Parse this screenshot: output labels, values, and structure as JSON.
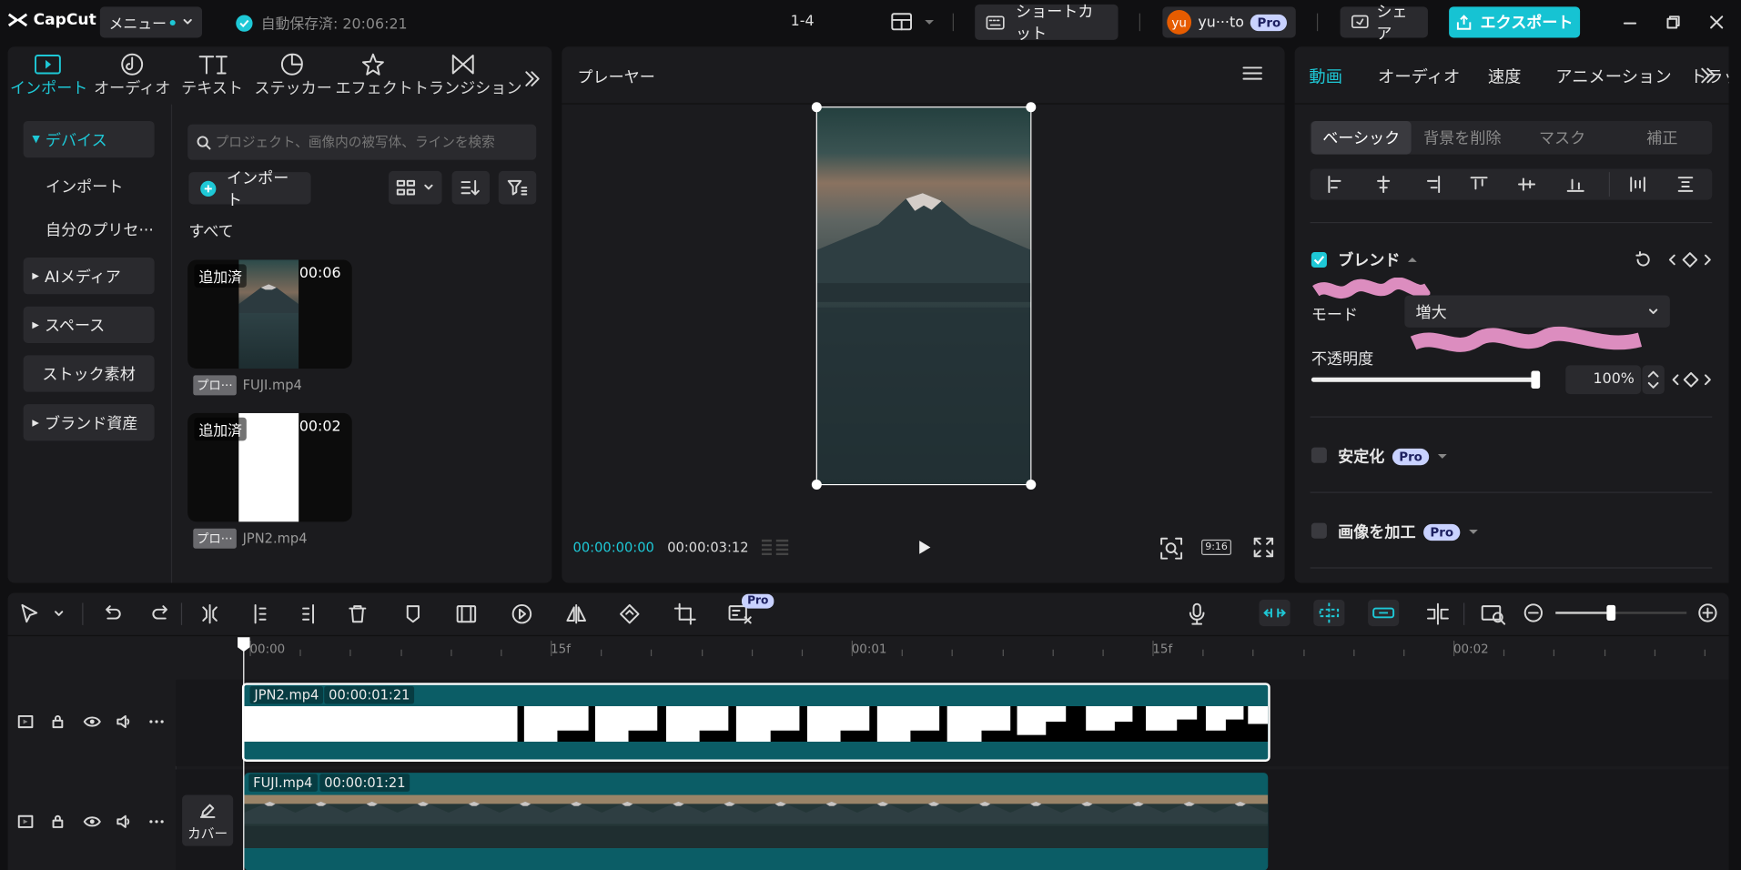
{
  "app": {
    "logo": "CapCut",
    "menu_label": "メニュー",
    "autosave": "自動保存済: 20:06:21",
    "project_name": "1-4",
    "shortcut_label": "ショートカット",
    "user_name": "yu···to",
    "user_initials": "yu",
    "pro_label": "Pro",
    "share_label": "シェア",
    "export_label": "エクスポート"
  },
  "media_tabs": [
    {
      "label": "インポート",
      "icon": "import-icon"
    },
    {
      "label": "オーディオ",
      "icon": "audio-icon"
    },
    {
      "label": "テキスト",
      "icon": "text-icon"
    },
    {
      "label": "ステッカー",
      "icon": "sticker-icon"
    },
    {
      "label": "エフェクト",
      "icon": "effect-icon"
    },
    {
      "label": "トランジション",
      "icon": "transition-icon"
    }
  ],
  "sidebar": {
    "device": "デバイス",
    "import": "インポート",
    "presets": "自分のプリセ···",
    "ai_media": "AIメディア",
    "space": "スペース",
    "stock": "ストック素材",
    "brand": "ブランド資産"
  },
  "media": {
    "search_placeholder": "プロジェクト、画像内の被写体、ラインを検索",
    "import_button": "インポート",
    "filter_all": "すべて",
    "items": [
      {
        "badge": "追加済",
        "duration": "00:06",
        "tag": "プロ···",
        "name": "FUJI.mp4"
      },
      {
        "badge": "追加済",
        "duration": "00:02",
        "tag": "プロ···",
        "name": "JPN2.mp4"
      }
    ]
  },
  "player": {
    "title": "プレーヤー",
    "current_time": "00:00:00:00",
    "total_time": "00:00:03:12",
    "ratio": "9:16"
  },
  "properties": {
    "tabs": [
      "動画",
      "オーディオ",
      "速度",
      "アニメーション",
      "トラッ"
    ],
    "subtabs": [
      "ベーシック",
      "背景を削除",
      "マスク",
      "補正"
    ],
    "blend_label": "ブレンド",
    "mode_label": "モード",
    "mode_value": "増大",
    "opacity_label": "不透明度",
    "opacity_value": "100%",
    "opacity_level": 1.0,
    "stabilize_label": "安定化",
    "enhance_label": "画像を加工",
    "pro_label": "Pro"
  },
  "colors": {
    "accent": "#1ec8d6",
    "export": "#16c3d3",
    "clip": "#0b5d66",
    "pro_badge": "#c9d2ff"
  },
  "timeline": {
    "ruler": [
      "00:00",
      "15f",
      "00:01",
      "15f",
      "00:02"
    ],
    "clips": [
      {
        "name": "JPN2.mp4",
        "duration": "00:00:01:21"
      },
      {
        "name": "FUJI.mp4",
        "duration": "00:00:01:21"
      }
    ],
    "cover_label": "カバー",
    "pro_label": "Pro"
  }
}
